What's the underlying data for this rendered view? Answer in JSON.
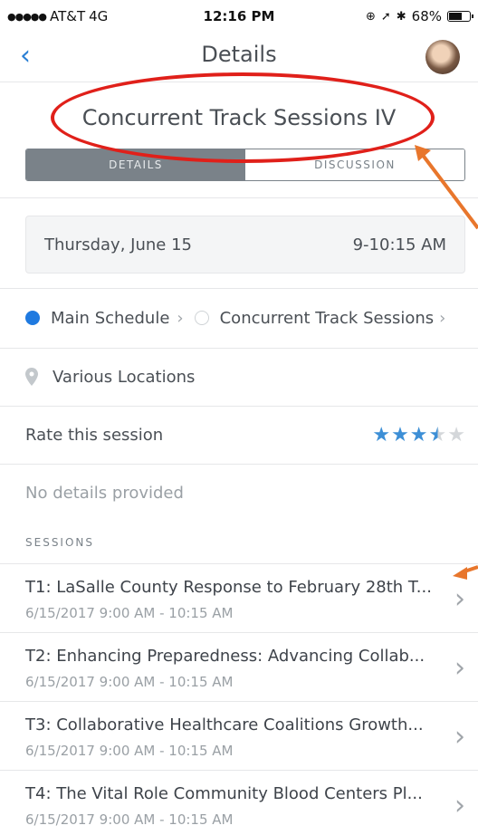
{
  "status_bar": {
    "carrier": "AT&T",
    "network": "4G",
    "time": "12:16 PM",
    "battery": "68%",
    "battery_level": 0.68
  },
  "nav": {
    "title": "Details",
    "back_icon": "chevron-left-icon",
    "avatar": "avatar"
  },
  "session": {
    "title": "Concurrent Track Sessions IV",
    "tabs": [
      "DETAILS",
      "DISCUSSION"
    ],
    "active_tab": "DETAILS",
    "date": "Thursday, June 15",
    "time": "9-10:15 AM",
    "schedule": [
      "Main Schedule",
      "Concurrent Track Sessions"
    ],
    "location": "Various Locations",
    "rate_label": "Rate this session",
    "rating": 3.5,
    "rating_max": 5,
    "no_details": "No details provided",
    "sessions_header": "SESSIONS"
  },
  "sessions": [
    {
      "name": "T1: LaSalle County Response to February 28th T...",
      "time": "6/15/2017 9:00 AM - 10:15 AM"
    },
    {
      "name": "T2: Enhancing Preparedness:  Advancing Collab...",
      "time": "6/15/2017 9:00 AM - 10:15 AM"
    },
    {
      "name": "T3: Collaborative Healthcare Coalitions Growth...",
      "time": "6/15/2017 9:00 AM - 10:15 AM"
    },
    {
      "name": "T4: The Vital Role Community Blood Centers Pl...",
      "time": "6/15/2017 9:00 AM - 10:15 AM"
    }
  ],
  "colors": {
    "accent": "#2a7fd4",
    "annotation_ellipse": "#e0201a",
    "annotation_arrow": "#e8762c",
    "star": "#3d8fd6"
  }
}
